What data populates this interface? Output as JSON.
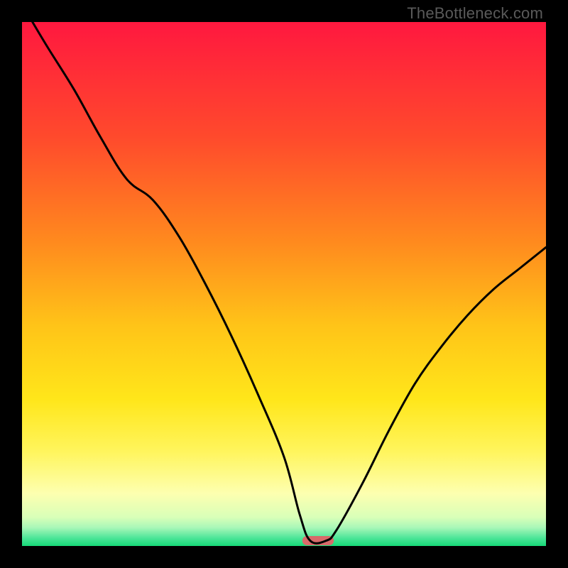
{
  "watermark": "TheBottleneck.com",
  "chart_data": {
    "type": "line",
    "title": "",
    "xlabel": "",
    "ylabel": "",
    "xlim": [
      0,
      100
    ],
    "ylim": [
      0,
      100
    ],
    "grid": false,
    "x": [
      2,
      5,
      10,
      15,
      20,
      25,
      30,
      35,
      40,
      45,
      50,
      53,
      55,
      58,
      60,
      65,
      70,
      75,
      80,
      85,
      90,
      95,
      100
    ],
    "values": [
      100,
      95,
      87,
      78,
      70,
      66,
      59,
      50,
      40,
      29,
      17,
      6,
      1,
      1,
      3,
      12,
      22,
      31,
      38,
      44,
      49,
      53,
      57
    ],
    "gradient_stops": [
      {
        "offset": 0.0,
        "color": "#ff183f"
      },
      {
        "offset": 0.22,
        "color": "#ff4a2c"
      },
      {
        "offset": 0.42,
        "color": "#ff8a1e"
      },
      {
        "offset": 0.58,
        "color": "#ffc418"
      },
      {
        "offset": 0.72,
        "color": "#ffe61a"
      },
      {
        "offset": 0.82,
        "color": "#fff55d"
      },
      {
        "offset": 0.9,
        "color": "#fdffb0"
      },
      {
        "offset": 0.945,
        "color": "#d9ffb8"
      },
      {
        "offset": 0.965,
        "color": "#a8f7b8"
      },
      {
        "offset": 0.985,
        "color": "#4be598"
      },
      {
        "offset": 1.0,
        "color": "#17d977"
      }
    ],
    "marker": {
      "x": 56.5,
      "width": 6.0,
      "color": "#d86a6a"
    }
  }
}
